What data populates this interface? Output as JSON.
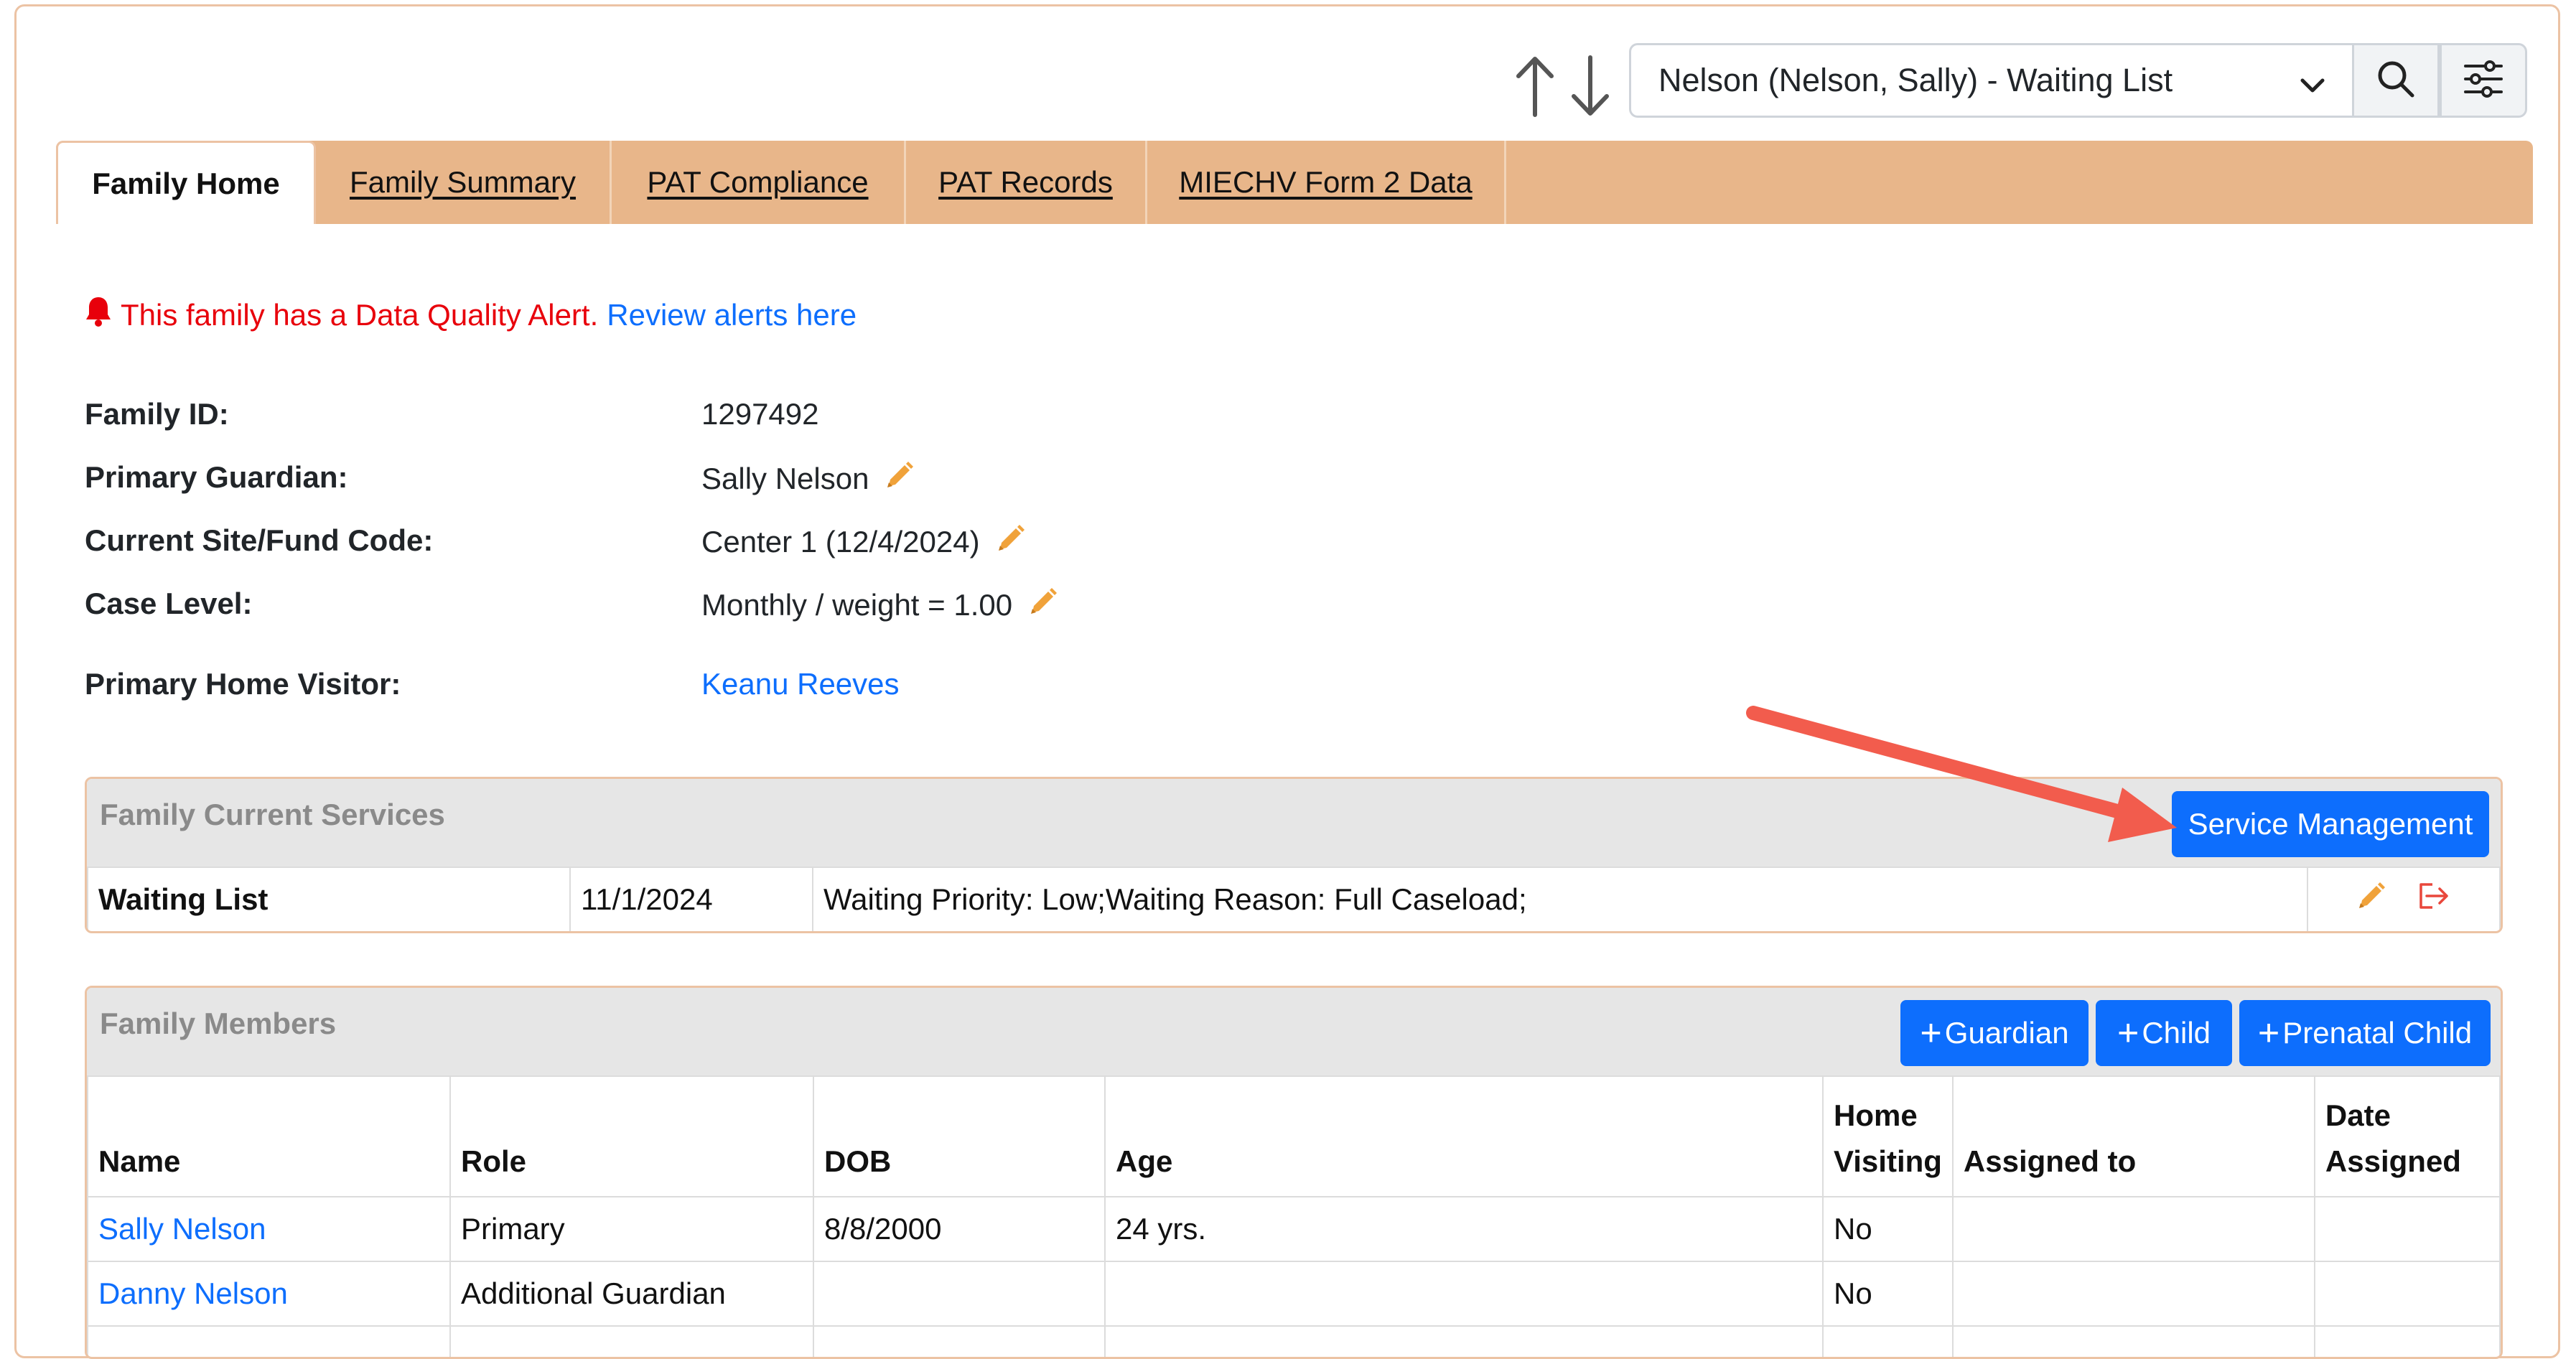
{
  "topbar": {
    "family_select_value": "Nelson (Nelson, Sally) - Waiting List",
    "up_icon": "arrow-up-icon",
    "down_icon": "arrow-down-icon",
    "search_icon": "search-icon",
    "filter_icon": "sliders-icon"
  },
  "tabs": [
    {
      "label": "Family Home",
      "active": true
    },
    {
      "label": "Family Summary"
    },
    {
      "label": "PAT Compliance"
    },
    {
      "label": "PAT Records"
    },
    {
      "label": "MIECHV Form 2 Data"
    }
  ],
  "alert": {
    "text": "This family has a Data Quality Alert.",
    "link": "Review alerts here",
    "icon": "bell-icon",
    "color": "#e8000b"
  },
  "info": {
    "family_id_label": "Family ID:",
    "family_id_value": "1297492",
    "guardian_label": "Primary Guardian:",
    "guardian_value": "Sally Nelson",
    "site_label": "Current Site/Fund Code:",
    "site_value": "Center 1 (12/4/2024)",
    "case_label": "Case Level:",
    "case_value": "Monthly / weight = 1.00",
    "visitor_label": "Primary Home Visitor:",
    "visitor_value": "Keanu Reeves"
  },
  "services": {
    "title": "Family Current Services",
    "button": "Service Management",
    "row": {
      "service": "Waiting List",
      "date": "11/1/2024",
      "details": "Waiting Priority: Low;Waiting Reason: Full Caseload;"
    }
  },
  "members": {
    "title": "Family Members",
    "buttons": {
      "guardian": "Guardian",
      "child": "Child",
      "prenatal": "Prenatal Child"
    },
    "headers": {
      "name": "Name",
      "role": "Role",
      "dob": "DOB",
      "age": "Age",
      "hv1": "Home",
      "hv2": "Visiting",
      "assigned": "Assigned to",
      "da1": "Date",
      "da2": "Assigned"
    },
    "rows": [
      {
        "name": "Sally Nelson",
        "role": "Primary",
        "dob": "8/8/2000",
        "age": "24 yrs.",
        "hv": "No",
        "assigned": "",
        "date": ""
      },
      {
        "name": "Danny Nelson",
        "role": "Additional Guardian",
        "dob": "",
        "age": "",
        "hv": "No",
        "assigned": "",
        "date": ""
      }
    ]
  },
  "colors": {
    "accent_blue": "#0d6efd",
    "tab_bar": "#e8b68a",
    "edit_icon": "#f0a23a",
    "annotation_arrow": "#f25c4d"
  }
}
